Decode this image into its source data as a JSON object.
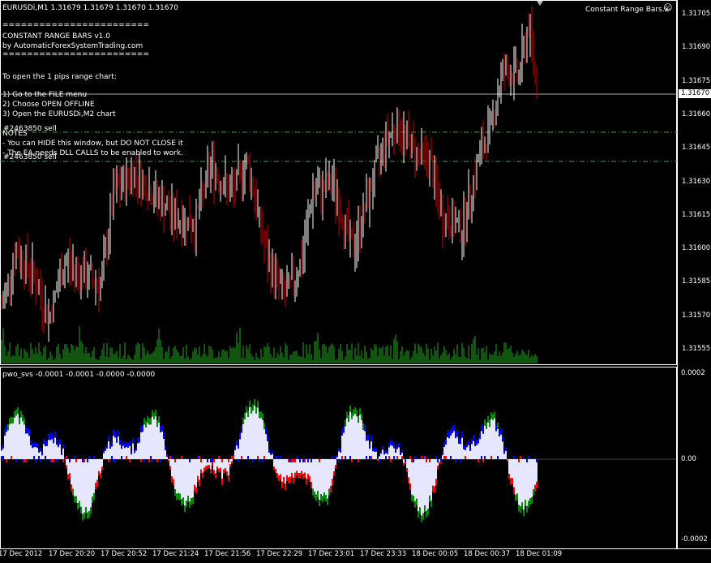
{
  "header": {
    "symbol_line": "EURUSDi,M1  1.31679 1.31679 1.31670 1.31670",
    "indicator_name": "Constant Range Bars.x"
  },
  "info_panel": {
    "lines": [
      "========================",
      "    CONSTANT RANGE BARS v1.0",
      " by AutomaticForexSystemTrading.com",
      "========================",
      "",
      "To open the 1 pips range chart:",
      "",
      " 1) Go to the FILE menu",
      " 2) Choose OPEN OFFLINE",
      " 3) Open the EURUSDi,M2 chart",
      "",
      "NOTES",
      " - You can HIDE this window, but DO NOT CLOSE it",
      " - The EA needs DLL CALLS to be enabled to work."
    ],
    "order_labels": [
      "#2463850 sell",
      "#2463850 sell"
    ]
  },
  "price_axis": {
    "ticks": [
      "1.31705",
      "1.31690",
      "1.31675",
      "1.31660",
      "1.31645",
      "1.31630",
      "1.31615",
      "1.31600",
      "1.31585",
      "1.31570",
      "1.31555"
    ],
    "current_price": "1.31670"
  },
  "sub_window": {
    "title": "pwo_svs -0.0001 -0.0001 -0.0000 -0.0000",
    "ticks": [
      "0.0002",
      "0.00",
      "-0.0002"
    ]
  },
  "time_axis": {
    "labels": [
      "17 Dec 2012",
      "17 Dec 20:20",
      "17 Dec 20:52",
      "17 Dec 21:24",
      "17 Dec 21:56",
      "17 Dec 22:29",
      "17 Dec 23:01",
      "17 Dec 23:33",
      "18 Dec 00:05",
      "18 Dec 00:37",
      "18 Dec 01:09"
    ]
  },
  "colors": {
    "background": "#000000",
    "bull_bar": "#ffffff",
    "bear_bar": "#cc0000",
    "volume": "#22aa22",
    "order_line": "#33aa33",
    "osc_fill": "#e6e6ff",
    "osc_red": "#ff0000",
    "osc_blue": "#0000ff",
    "osc_green": "#008800"
  }
}
